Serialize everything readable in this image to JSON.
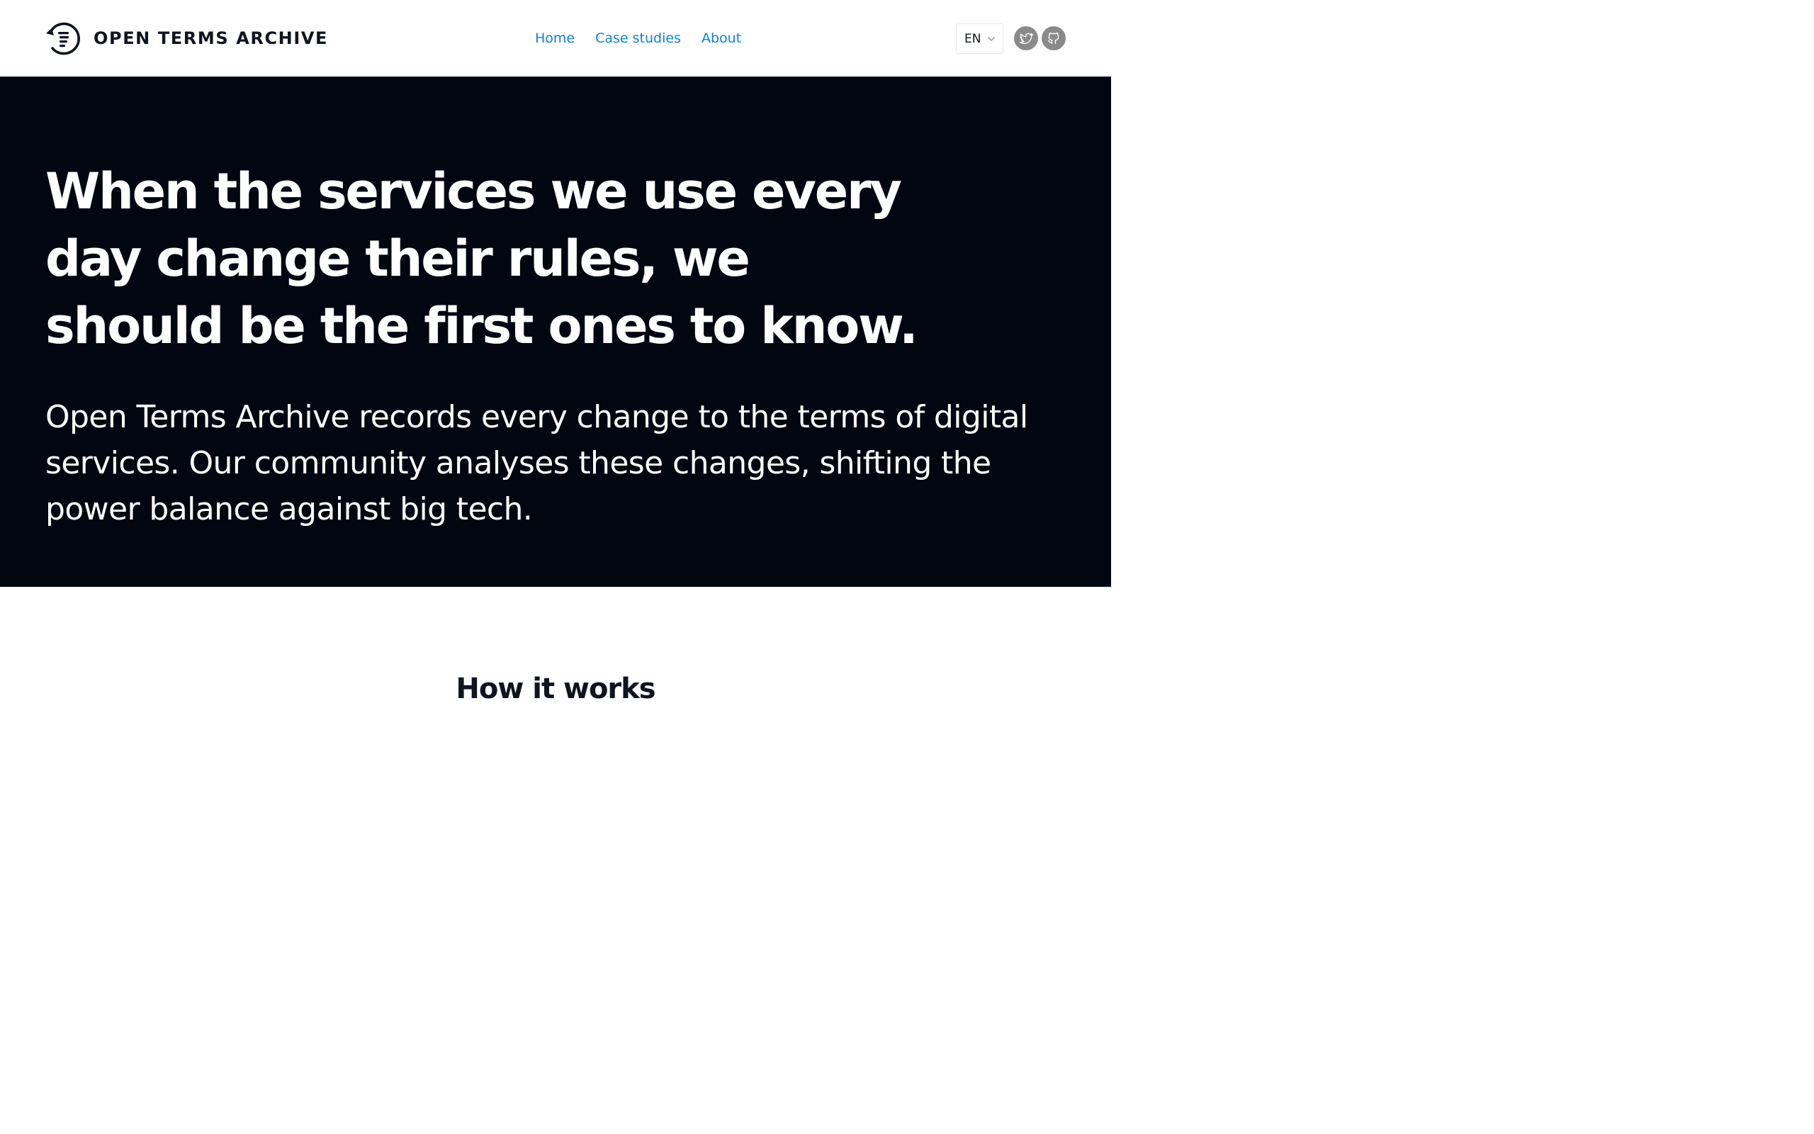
{
  "brand": {
    "name": "OPEN TERMS ARCHIVE",
    "logo_icon": "open-terms-archive-logo-icon"
  },
  "nav": {
    "items": [
      {
        "label": "Home"
      },
      {
        "label": "Case studies"
      },
      {
        "label": "About"
      }
    ]
  },
  "language": {
    "selected": "EN",
    "icon": "chevron-down-icon"
  },
  "social": {
    "twitter_icon": "twitter-icon",
    "github_icon": "github-icon"
  },
  "hero": {
    "title": "When the services we use every day change their rules, we should be the first ones to know.",
    "subtitle": "Open Terms Archive records every change to the terms of digital services. Our community analyses these changes, shifting the power balance against big tech."
  },
  "how_it_works": {
    "heading": "How it works"
  },
  "colors": {
    "link": "#0e82d6",
    "hero_background": "#020611",
    "text_dark": "#0f1420",
    "social_icon_background": "#8a8a8a"
  }
}
